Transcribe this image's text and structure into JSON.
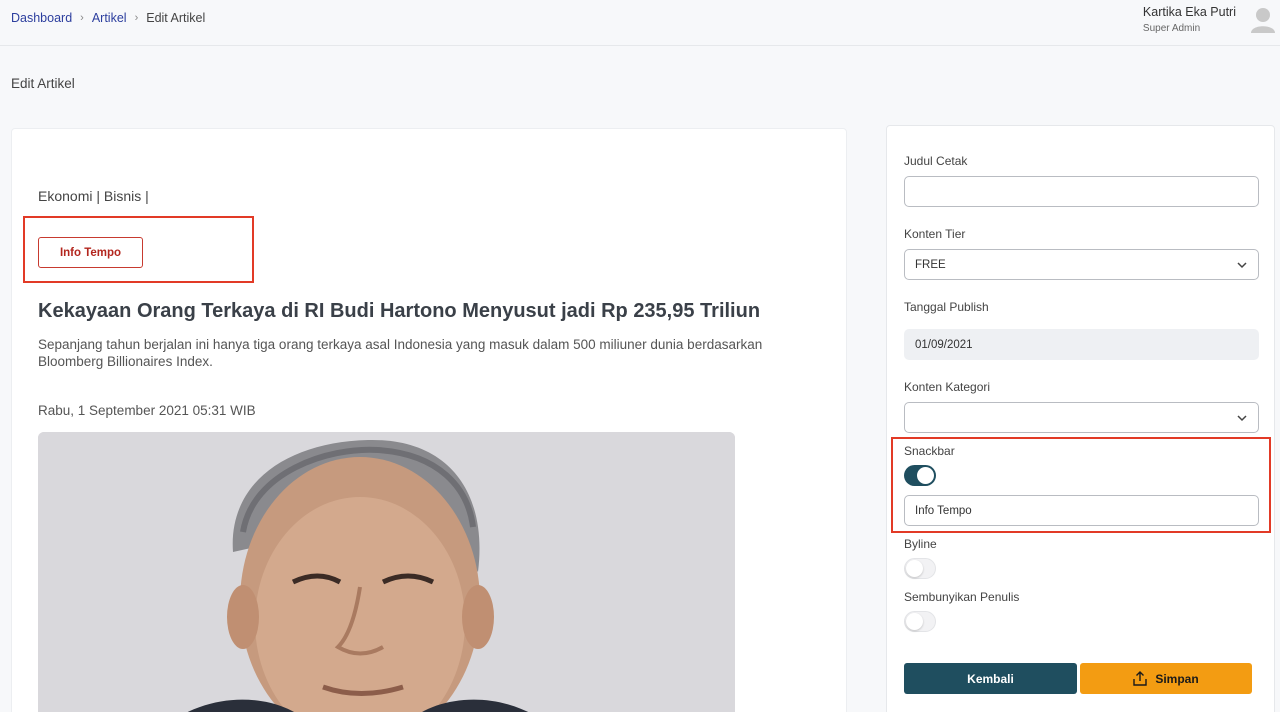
{
  "breadcrumb": {
    "items": [
      "Dashboard",
      "Artikel"
    ],
    "current": "Edit Artikel"
  },
  "user": {
    "name": "Kartika Eka Putri",
    "role": "Super Admin"
  },
  "page": {
    "title": "Edit Artikel"
  },
  "article": {
    "category": "Ekonomi | Bisnis |",
    "tag_button": "Info Tempo",
    "headline": "Kekayaan Orang Terkaya di RI Budi Hartono Menyusut jadi Rp 235,95 Triliun",
    "summary": "Sepanjang tahun berjalan ini hanya tiga orang terkaya asal Indonesia yang masuk dalam 500 miliuner dunia berdasarkan Bloomberg Billionaires Index.",
    "date": "Rabu, 1 September 2021 05:31 WIB"
  },
  "form": {
    "judul_cetak": {
      "label": "Judul Cetak",
      "value": ""
    },
    "konten_tier": {
      "label": "Konten Tier",
      "value": "FREE"
    },
    "tanggal_publish": {
      "label": "Tanggal Publish",
      "value": "01/09/2021"
    },
    "konten_kategori": {
      "label": "Konten Kategori",
      "value": ""
    },
    "snackbar": {
      "label": "Snackbar",
      "enabled": true,
      "value": "Info Tempo"
    },
    "byline": {
      "label": "Byline",
      "enabled": false
    },
    "sembunyikan_penulis": {
      "label": "Sembunyikan Penulis",
      "enabled": false
    },
    "back_label": "Kembali",
    "save_label": "Simpan"
  },
  "colors": {
    "primary": "#1f4e5f",
    "accent": "#f39c12",
    "link": "#2c3e9e",
    "highlight": "#e23a26"
  },
  "icons": {
    "breadcrumb_sep": "chevron-right-icon",
    "select": "chevron-down-icon",
    "save": "upload-icon",
    "user": "user-avatar-icon"
  }
}
